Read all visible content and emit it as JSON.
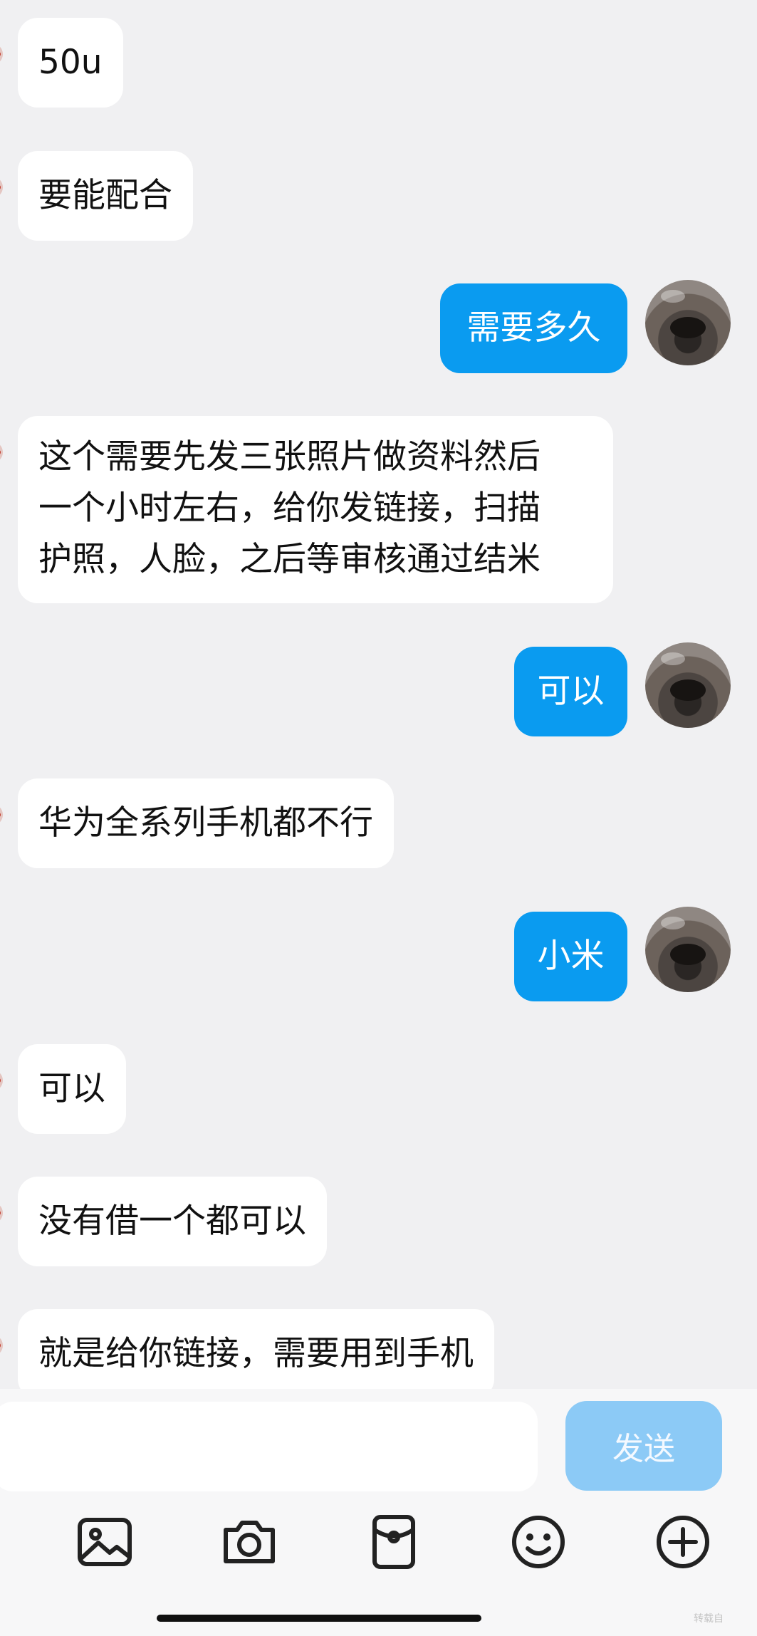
{
  "messages": [
    {
      "side": "in",
      "text": "50u"
    },
    {
      "side": "in",
      "text": "要能配合"
    },
    {
      "side": "out",
      "text": "需要多久"
    },
    {
      "side": "in",
      "lines": [
        "这个需要先发三张照片做资料然后",
        "一个小时左右，给你发链接，扫描",
        "护照，人脸，之后等审核通过结米"
      ]
    },
    {
      "side": "out",
      "text": "可以"
    },
    {
      "side": "in",
      "text": "华为全系列手机都不行"
    },
    {
      "side": "out",
      "text": "小米"
    },
    {
      "side": "in",
      "text": "可以"
    },
    {
      "side": "in",
      "text": "没有借一个都可以"
    },
    {
      "side": "in",
      "text": "就是给你链接，需要用到手机"
    }
  ],
  "composer": {
    "input_value": "",
    "send_label": "发送"
  },
  "toolbar": {
    "icons": [
      "image-icon",
      "camera-icon",
      "red-packet-icon",
      "emoji-icon",
      "plus-icon"
    ]
  },
  "watermark": "转载自",
  "colors": {
    "background": "#f0f0f2",
    "incoming_bubble": "#ffffff",
    "outgoing_bubble": "#0a9bf0",
    "send_button_disabled": "#8ccaf6"
  }
}
